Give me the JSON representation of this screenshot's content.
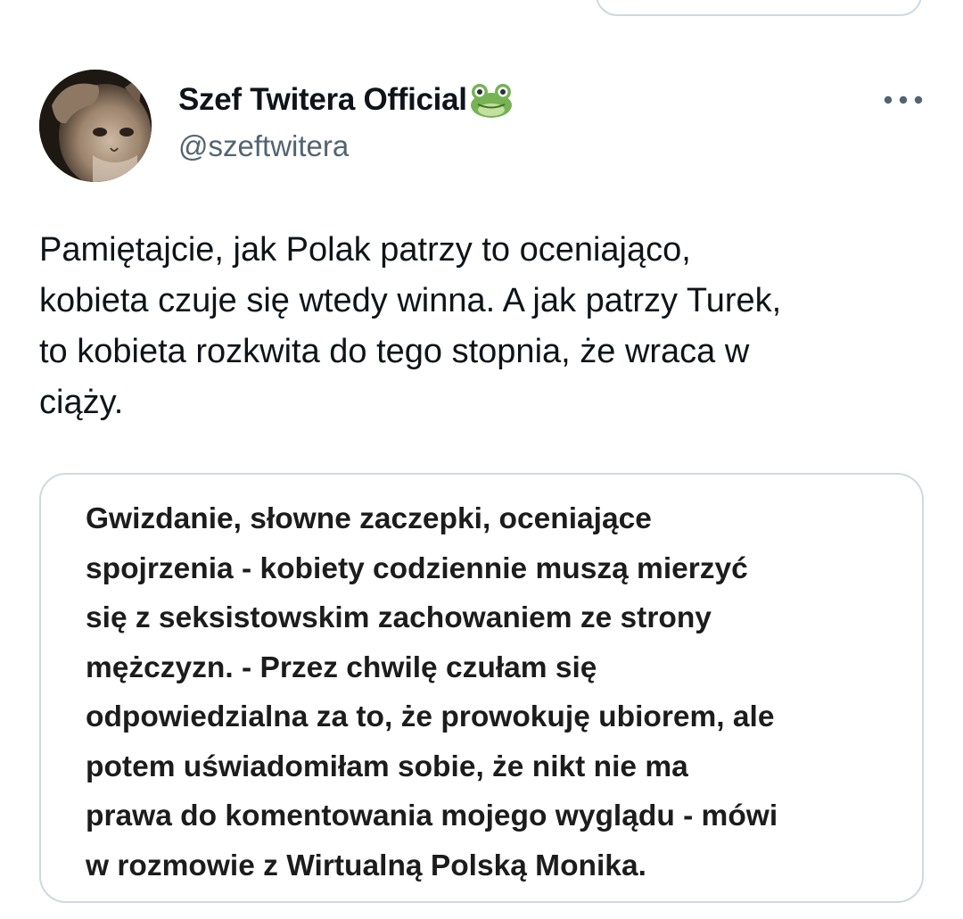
{
  "author": {
    "display_name": "Szef Twitera Official",
    "handle": "@szeftwitera",
    "avatar_icon": "cat-saluting-avatar",
    "name_emoji": "frog-face-icon"
  },
  "menu": {
    "icon": "more-horizontal-icon"
  },
  "tweet": {
    "text": "Pamiętajcie, jak Polak patrzy to oceniająco,\nkobieta czuje się wtedy winna. A jak patrzy Turek,\nto kobieta rozkwita do tego stopnia, że wraca w\nciąży."
  },
  "media": {
    "text": "Gwizdanie, słowne zaczepki, oceniające\nspojrzenia - kobiety codziennie muszą mierzyć\nsię z seksistowskim zachowaniem ze strony\nmężczyzn. - Przez chwilę czułam się\nodpowiedzialna za to, że prowokuję ubiorem, ale\npotem uświadomiłam sobie, że nikt nie ma\nprawa do komentowania mojego wyglądu - mówi\nw rozmowie z Wirtualną Polską Monika."
  },
  "colors": {
    "text_primary": "#0f1419",
    "text_secondary": "#536471",
    "border": "#cfd9de"
  }
}
